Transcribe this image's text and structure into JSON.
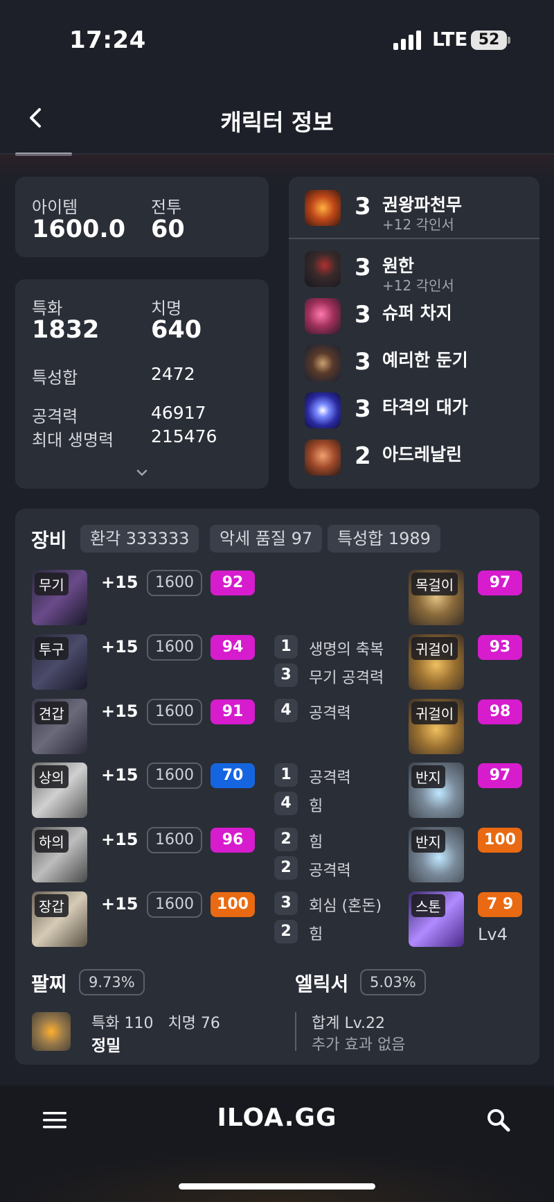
{
  "status_bar": {
    "time": "17:24",
    "network": "LTE",
    "battery": "52"
  },
  "header": {
    "title": "캐릭터 정보"
  },
  "level_card": {
    "item_label": "아이템",
    "item_value": "1600.0",
    "combat_label": "전투",
    "combat_value": "60"
  },
  "stats_card": {
    "spec_label": "특화",
    "spec_value": "1832",
    "crit_label": "치명",
    "crit_value": "640",
    "total_label": "특성합",
    "total_value": "2472",
    "atk_label": "공격력",
    "atk_value": "46917",
    "hp_label": "최대 생명력",
    "hp_value": "215476"
  },
  "engravings": [
    {
      "level": "3",
      "name": "권왕파천무",
      "sub": "+12 각인서"
    },
    {
      "level": "3",
      "name": "원한",
      "sub": "+12 각인서"
    },
    {
      "level": "3",
      "name": "슈퍼 차지",
      "sub": ""
    },
    {
      "level": "3",
      "name": "예리한 둔기",
      "sub": ""
    },
    {
      "level": "3",
      "name": "타격의 대가",
      "sub": ""
    },
    {
      "level": "2",
      "name": "아드레날린",
      "sub": ""
    }
  ],
  "equipment": {
    "title": "장비",
    "chips": [
      "환각 333333",
      "악세 품질 97",
      "특성합 1989"
    ],
    "gear": [
      {
        "tag": "무기",
        "upgrade": "+15",
        "ilvl": "1600",
        "quality": "92"
      },
      {
        "tag": "투구",
        "upgrade": "+15",
        "ilvl": "1600",
        "quality": "94"
      },
      {
        "tag": "견갑",
        "upgrade": "+15",
        "ilvl": "1600",
        "quality": "91"
      },
      {
        "tag": "상의",
        "upgrade": "+15",
        "ilvl": "1600",
        "quality": "70"
      },
      {
        "tag": "하의",
        "upgrade": "+15",
        "ilvl": "1600",
        "quality": "96"
      },
      {
        "tag": "장갑",
        "upgrade": "+15",
        "ilvl": "1600",
        "quality": "100"
      }
    ],
    "effects": [
      {
        "num": "1",
        "name": "생명의 축복"
      },
      {
        "num": "3",
        "name": "무기 공격력"
      },
      {
        "num": "4",
        "name": "공격력"
      },
      {
        "num": "1",
        "name": "공격력"
      },
      {
        "num": "4",
        "name": "힘"
      },
      {
        "num": "2",
        "name": "힘"
      },
      {
        "num": "2",
        "name": "공격력"
      },
      {
        "num": "3",
        "name": "회심 (혼돈)"
      },
      {
        "num": "2",
        "name": "힘"
      }
    ],
    "accessories": [
      {
        "tag": "목걸이",
        "quality": "97"
      },
      {
        "tag": "귀걸이",
        "quality": "93"
      },
      {
        "tag": "귀걸이",
        "quality": "98"
      },
      {
        "tag": "반지",
        "quality": "97"
      },
      {
        "tag": "반지",
        "quality": "100"
      },
      {
        "tag": "스톤",
        "quality": "7 9",
        "level": "Lv4"
      }
    ]
  },
  "bracelet": {
    "title": "팔찌",
    "percent": "9.73%",
    "stats": "특화 110   치명 76",
    "effect": "정밀"
  },
  "elixir": {
    "title": "엘릭서",
    "percent": "5.03%",
    "total": "합계 Lv.22",
    "extra": "추가 효과 없음"
  },
  "bottom_nav": {
    "logo": "ILOA.GG"
  },
  "colors": {
    "background": "#1d2028",
    "card": "#2a2e37",
    "quality_pink": "#d61ccd",
    "quality_blue": "#1565e0",
    "quality_orange": "#e96a12"
  }
}
